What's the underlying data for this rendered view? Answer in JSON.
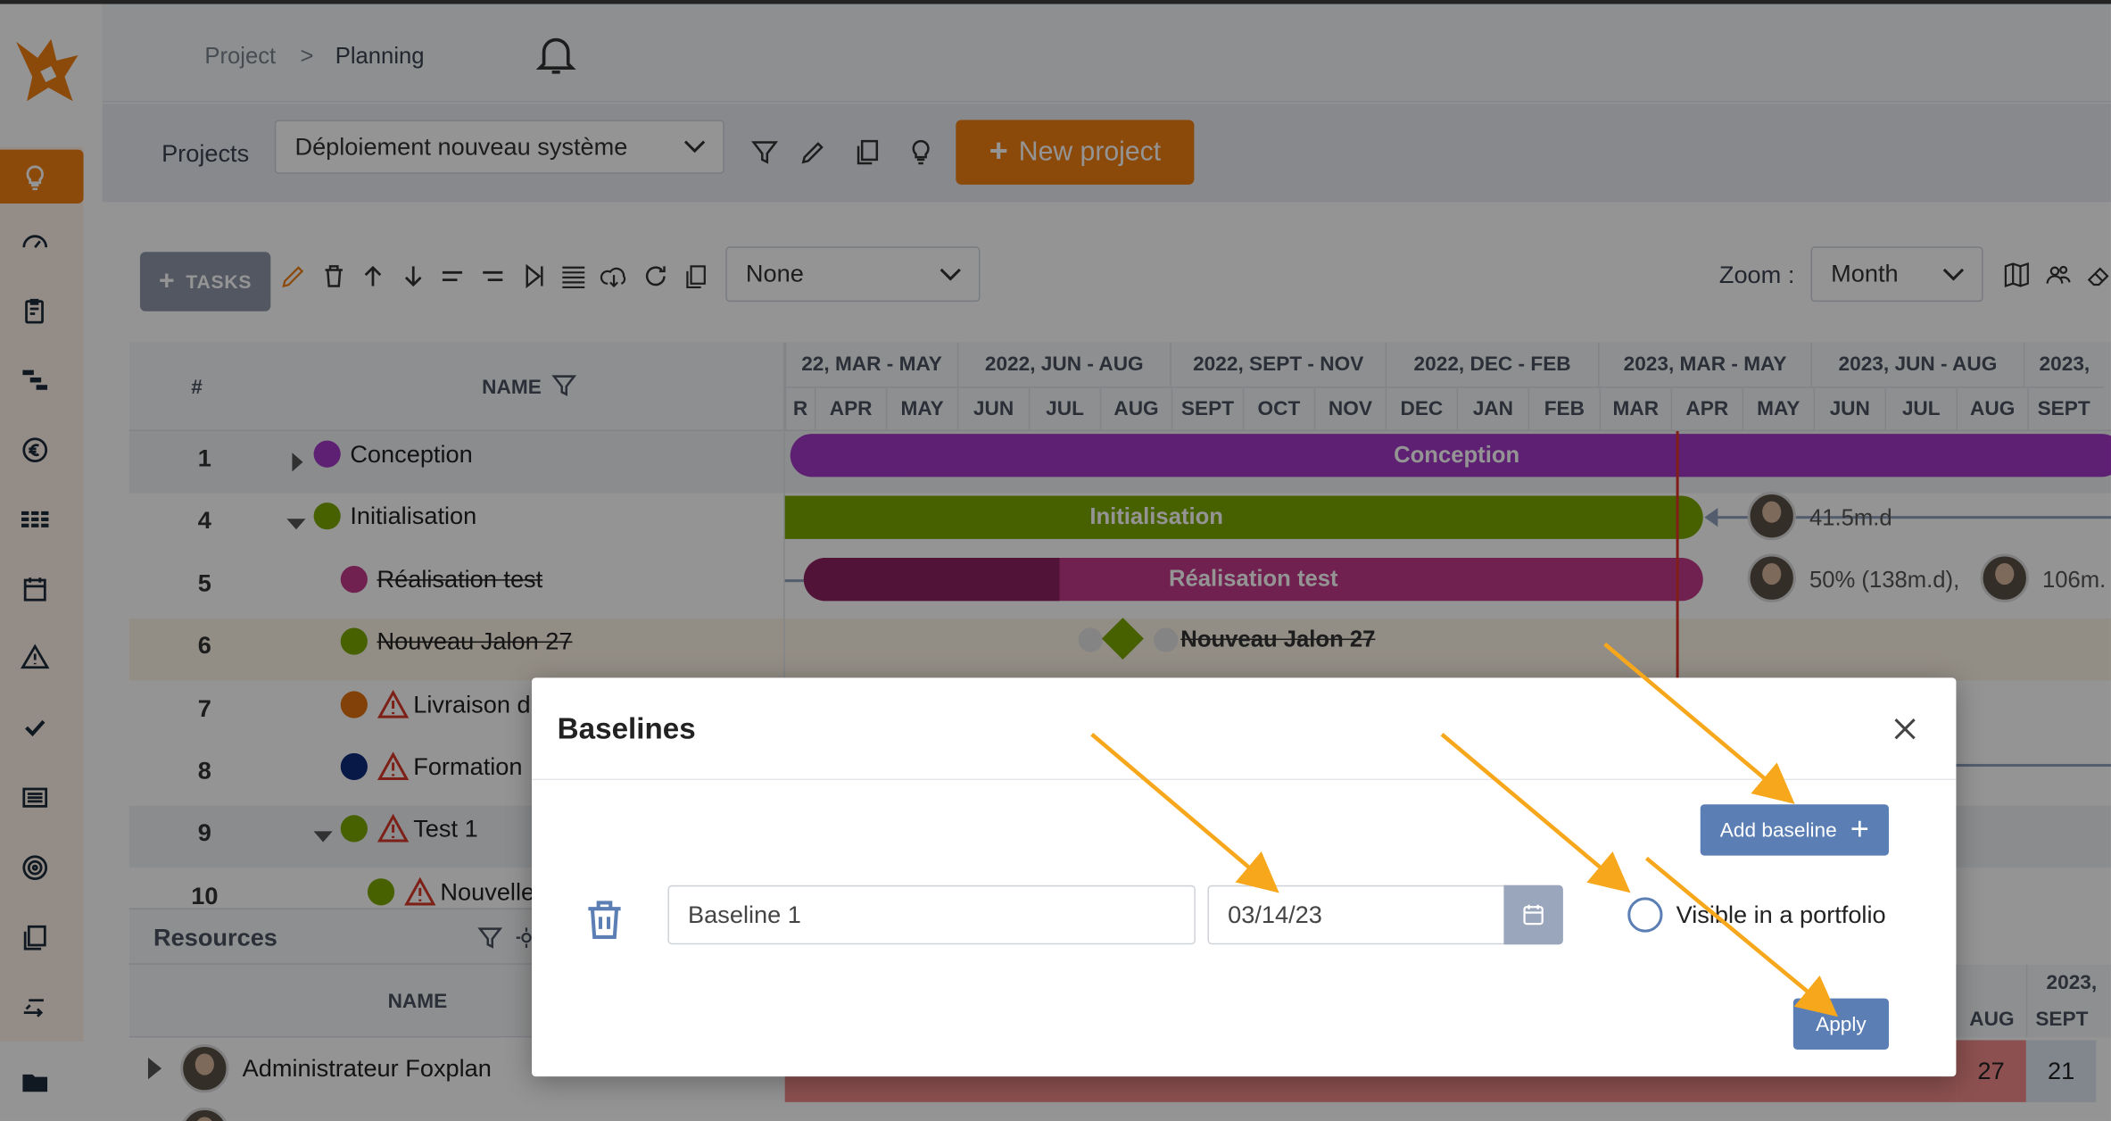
{
  "breadcrumb": {
    "root": "Project",
    "separator": ">",
    "current": "Planning"
  },
  "projects": {
    "label": "Projects",
    "selected": "Déploiement nouveau système",
    "new_button": "New project"
  },
  "tasks_toolbar": {
    "tasks_button": "TASKS",
    "filter_select": "None",
    "zoom_label": "Zoom :",
    "zoom_value": "Month"
  },
  "grid": {
    "col_number": "#",
    "col_name": "NAME",
    "rows": [
      {
        "num": "1",
        "name": "Conception",
        "color": "#a237c4"
      },
      {
        "num": "4",
        "name": "Initialisation",
        "color": "#7ba800"
      },
      {
        "num": "5",
        "name": "Réalisation test",
        "color": "#c2398a"
      },
      {
        "num": "6",
        "name": "Nouveau Jalon 27",
        "color": "#7ba800"
      },
      {
        "num": "7",
        "name": "Livraison d",
        "color": "#e07010"
      },
      {
        "num": "8",
        "name": "Formation",
        "color": "#0f2a7a"
      },
      {
        "num": "9",
        "name": "Test 1",
        "color": "#7ba800"
      },
      {
        "num": "10",
        "name": "Nouvelle",
        "color": "#7ba800"
      }
    ]
  },
  "timeline": {
    "quarters": [
      "22, MAR - MAY",
      "2022, JUN - AUG",
      "2022, SEPT - NOV",
      "2022, DEC - FEB",
      "2023, MAR - MAY",
      "2023, JUN - AUG",
      "2023, "
    ],
    "months": [
      "R",
      "APR",
      "MAY",
      "JUN",
      "JUL",
      "AUG",
      "SEPT",
      "OCT",
      "NOV",
      "DEC",
      "JAN",
      "FEB",
      "MAR",
      "APR",
      "MAY",
      "JUN",
      "JUL",
      "AUG",
      "SEPT"
    ],
    "bars": {
      "conception": "Conception",
      "initialisation": "Initialisation",
      "realisation": "Réalisation test",
      "jalon": "Nouveau Jalon 27"
    },
    "labels": {
      "init_load": "41.5m.d",
      "real_load_1": "50% (138m.d),",
      "real_load_2": "106m."
    }
  },
  "resources": {
    "title": "Resources",
    "col_name": "NAME",
    "rows": [
      {
        "name": "Administrateur Foxplan"
      }
    ],
    "lower_quarter": "2023, ",
    "lower_months": [
      "AUG",
      "SEPT"
    ],
    "lower_values": [
      "27",
      "21"
    ]
  },
  "modal": {
    "title": "Baselines",
    "add_button": "Add baseline",
    "baseline_name": "Baseline 1",
    "baseline_date": "03/14/23",
    "visible_label": "Visible in a portfolio",
    "apply_button": "Apply"
  },
  "colors": {
    "accent": "#f07e12",
    "primary_blue": "#5b7fb4",
    "arrow": "#f7a71c"
  }
}
